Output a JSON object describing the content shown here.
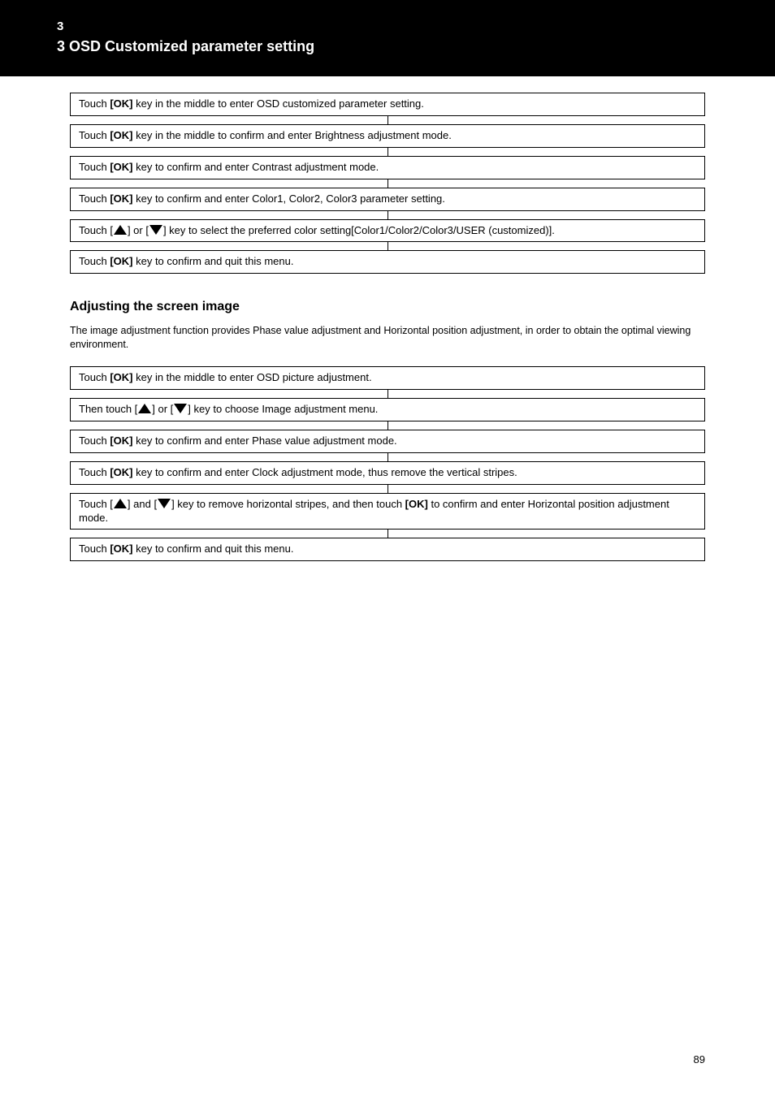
{
  "header": {
    "section_num": "3",
    "section_title": "3 OSD Customized parameter setting"
  },
  "flow1": [
    {
      "text_parts": [
        "Touch",
        " [OK]",
        " key in the middle to enter OSD customized parameter setting."
      ],
      "bolds": [
        false,
        true,
        false
      ]
    },
    {
      "text_parts": [
        "Touch",
        " [OK]",
        " key in the middle to confirm and enter Brightness adjustment mode."
      ],
      "bolds": [
        false,
        true,
        false
      ]
    },
    {
      "text_parts": [
        "Touch",
        " [OK]",
        " key to confirm and enter Contrast adjustment mode."
      ],
      "bolds": [
        false,
        true,
        false
      ]
    },
    {
      "text_parts": [
        "Touch",
        " [OK]",
        " key to confirm and enter Color1, Color2, Color3 parameter setting."
      ],
      "bolds": [
        false,
        true,
        false
      ]
    },
    {
      "text_parts": [
        "Touch",
        " [",
        "▲",
        "] or [",
        "▼",
        "] key to select the preferred color setting[Color1/Color2/Color3/USER (customized)]."
      ],
      "bolds": [
        false,
        false,
        false,
        false,
        false,
        false
      ]
    },
    {
      "text_parts": [
        "Touch",
        " [OK]",
        " key to confirm and quit this menu."
      ],
      "bolds": [
        false,
        true,
        false
      ]
    }
  ],
  "section2": {
    "title": "Adjusting the screen image",
    "sub": "The image adjustment function provides Phase value adjustment and Horizontal position adjustment, in order to obtain the optimal viewing environment."
  },
  "flow2": [
    {
      "text_parts": [
        "Touch",
        " [OK]",
        " key in the middle to enter OSD picture adjustment."
      ],
      "bolds": [
        false,
        true,
        false
      ]
    },
    {
      "text_parts": [
        "Then touch [",
        "▲",
        "] or [",
        "▼",
        "] key to choose Image adjustment menu."
      ],
      "bolds": [
        false,
        false,
        false,
        false,
        false
      ]
    },
    {
      "text_parts": [
        "Touch",
        " [OK]",
        " key to confirm and enter Phase value adjustment mode."
      ],
      "bolds": [
        false,
        true,
        false
      ]
    },
    {
      "text_parts": [
        "Touch",
        " [OK]",
        " key to confirm and enter Clock adjustment mode, thus remove the vertical stripes."
      ],
      "bolds": [
        false,
        true,
        false
      ]
    },
    {
      "text_parts": [
        "Touch [",
        "▲",
        "] and [",
        "▼",
        "] key to remove horizontal stripes, and then touch",
        " [OK]",
        " to confirm and enter Horizontal position adjustment mode."
      ],
      "bolds": [
        false,
        false,
        false,
        false,
        false,
        true,
        false
      ]
    },
    {
      "text_parts": [
        "Touch",
        " [OK]",
        " key to confirm and quit this menu."
      ],
      "bolds": [
        false,
        true,
        false
      ]
    }
  ],
  "page": "89"
}
